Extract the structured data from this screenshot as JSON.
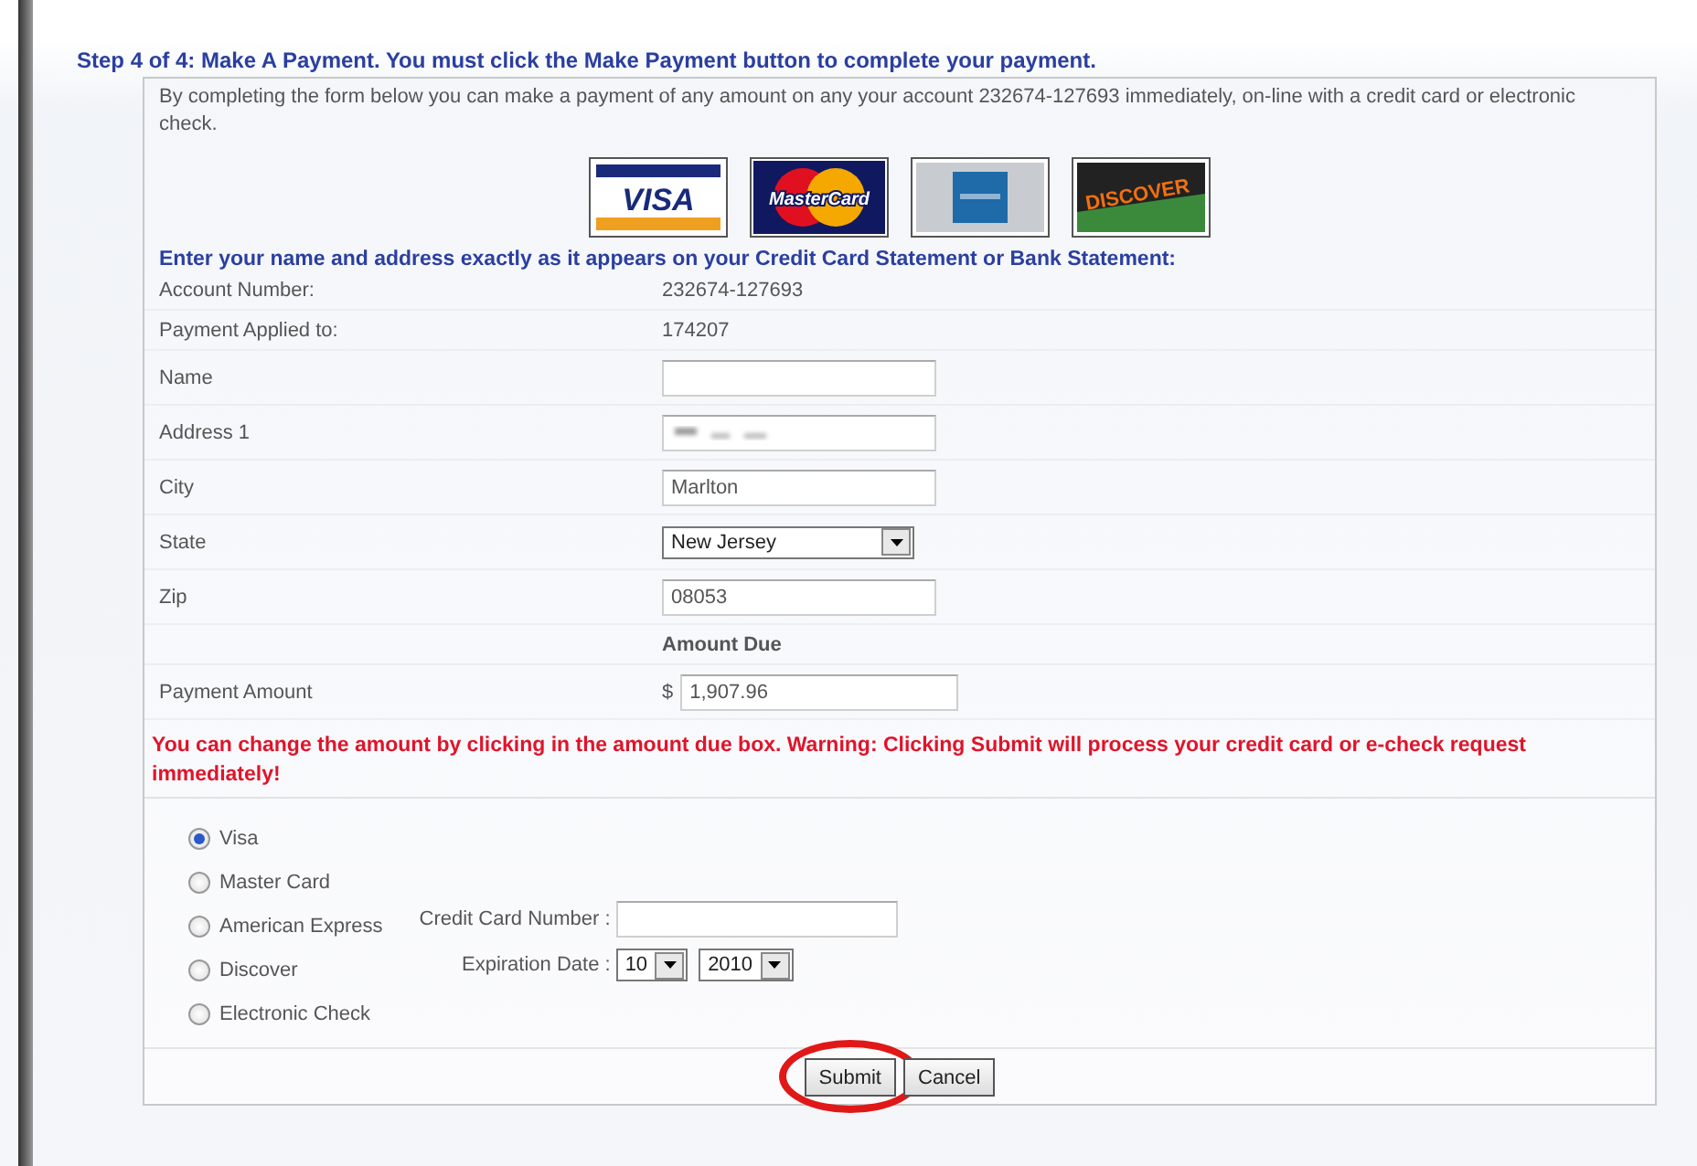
{
  "heading": "Step 4 of 4: Make A Payment.  You must click the Make Payment button to complete your payment.",
  "intro": "By completing the form below you can make a payment of any amount on any your account 232674-127693 immediately, on-line with a credit card or electronic check.",
  "card_logos": [
    {
      "kind": "visa",
      "label": "VISA"
    },
    {
      "kind": "mastercard",
      "label": "MasterCard"
    },
    {
      "kind": "amex"
    },
    {
      "kind": "discover",
      "label": "DISCOVER"
    }
  ],
  "instruction": "Enter your name and address exactly as it appears on your Credit Card Statement or Bank Statement:",
  "fields": [
    {
      "kind": "text",
      "label": "Account Number:",
      "value": "232674-127693"
    },
    {
      "kind": "text",
      "label": "Payment Applied to:",
      "value": "174207"
    },
    {
      "kind": "input",
      "label": "Name"
    },
    {
      "kind": "input",
      "label": "Address 1",
      "redacted": true
    },
    {
      "kind": "input",
      "label": "City",
      "value": "Marlton"
    },
    {
      "kind": "select",
      "label": "State",
      "value": "New Jersey"
    },
    {
      "kind": "input",
      "label": "Zip",
      "value": "08053"
    },
    {
      "kind": "heading",
      "value": "Amount Due"
    },
    {
      "kind": "amount",
      "label": "Payment Amount",
      "currency": "$",
      "value": "1,907.96"
    }
  ],
  "warning": "You can change the amount by clicking in the amount due box. Warning: Clicking Submit will process your credit card or e-check request immediately!",
  "payment_methods": [
    {
      "label": "Visa",
      "selected": true
    },
    {
      "label": "Master Card",
      "selected": false
    },
    {
      "label": "American Express",
      "selected": false
    },
    {
      "label": "Discover",
      "selected": false
    },
    {
      "label": "Electronic Check",
      "selected": false
    }
  ],
  "card_number": {
    "label": "Credit Card Number :"
  },
  "expiration": {
    "label": "Expiration Date :",
    "month": "10",
    "year": "2010"
  },
  "buttons": [
    {
      "label": "Submit",
      "highlighted": true
    },
    {
      "label": "Cancel",
      "highlighted": false
    }
  ]
}
